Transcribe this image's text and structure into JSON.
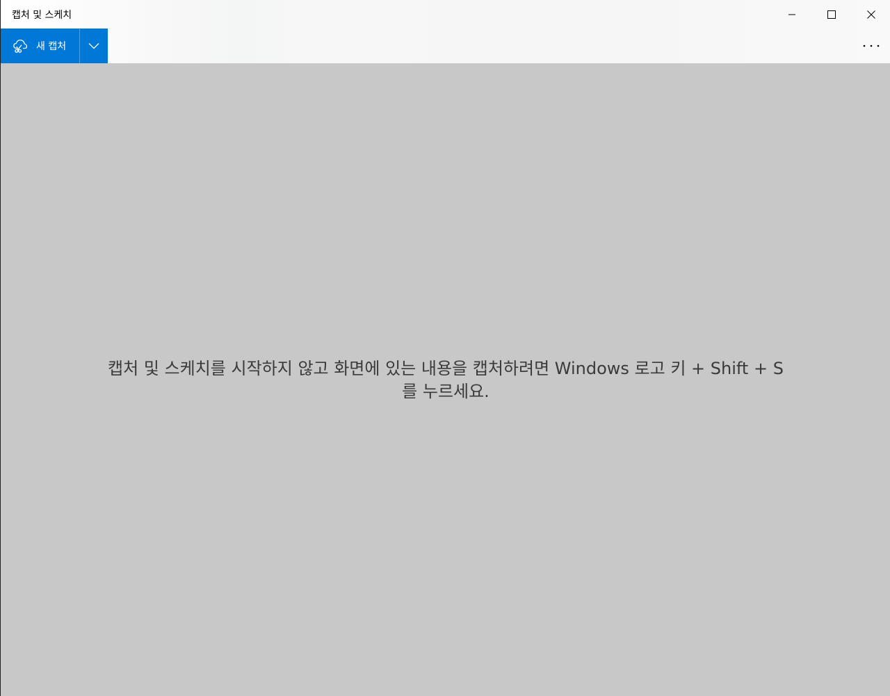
{
  "window": {
    "title": "캡처 및 스케치"
  },
  "title_bar_controls": {
    "minimize_icon": "minimize-icon",
    "maximize_icon": "maximize-icon",
    "close_icon": "close-icon"
  },
  "toolbar": {
    "new_snip_label": "새 캡처",
    "new_snip_icon": "snip-scissors-icon",
    "dropdown_icon": "chevron-down-icon",
    "more_icon": "more-horizontal-icon",
    "accent_color": "#0078d7"
  },
  "canvas": {
    "background_color": "#c8c8c8",
    "hint_line1": "캡처 및 스케치를 시작하지 않고 화면에 있는 내용을 캡처하려면 Windows 로고 키 + Shift + S",
    "hint_line2": "를 누르세요."
  }
}
